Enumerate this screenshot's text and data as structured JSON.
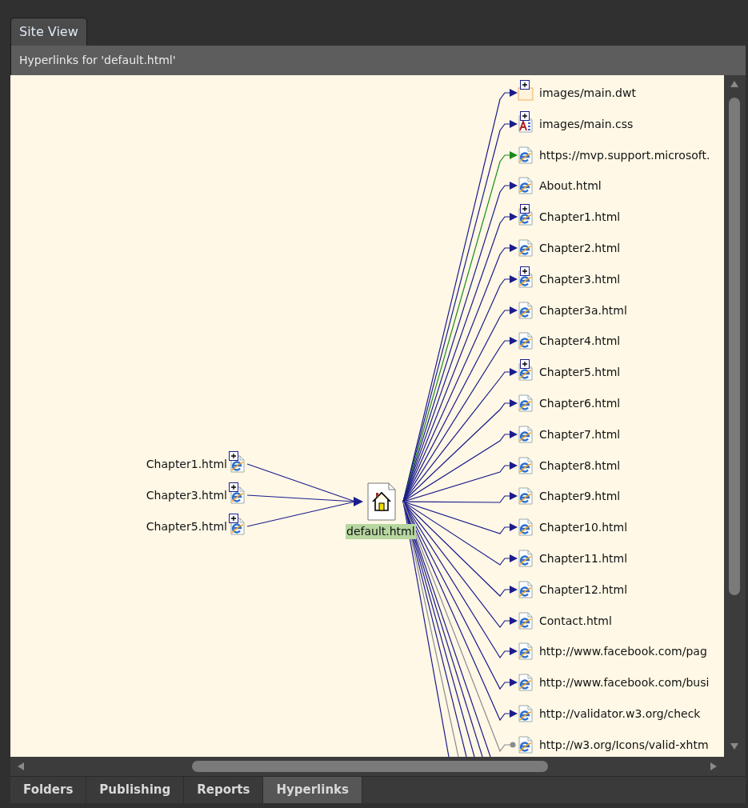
{
  "tabs": [
    {
      "label": "Site View",
      "selected": true
    }
  ],
  "header": "Hyperlinks for 'default.html'",
  "center": {
    "label": "default.html",
    "selected": true
  },
  "sources": [
    {
      "label": "Chapter1.html",
      "expandable": true
    },
    {
      "label": "Chapter3.html",
      "expandable": true
    },
    {
      "label": "Chapter5.html",
      "expandable": true
    }
  ],
  "targets": [
    {
      "label": "images/main.dwt",
      "kind": "template",
      "expandable": true,
      "color": "#1c1c8c"
    },
    {
      "label": "images/main.css",
      "kind": "stylesheet",
      "expandable": true,
      "color": "#1c1c8c"
    },
    {
      "label": "https://mvp.support.microsoft.",
      "kind": "page",
      "expandable": false,
      "color": "#1a8a1a"
    },
    {
      "label": "About.html",
      "kind": "page",
      "expandable": false,
      "color": "#1c1c8c"
    },
    {
      "label": "Chapter1.html",
      "kind": "page",
      "expandable": true,
      "color": "#1c1c8c"
    },
    {
      "label": "Chapter2.html",
      "kind": "page",
      "expandable": false,
      "color": "#1c1c8c"
    },
    {
      "label": "Chapter3.html",
      "kind": "page",
      "expandable": true,
      "color": "#1c1c8c"
    },
    {
      "label": "Chapter3a.html",
      "kind": "page",
      "expandable": false,
      "color": "#1c1c8c"
    },
    {
      "label": "Chapter4.html",
      "kind": "page",
      "expandable": false,
      "color": "#1c1c8c"
    },
    {
      "label": "Chapter5.html",
      "kind": "page",
      "expandable": true,
      "color": "#1c1c8c"
    },
    {
      "label": "Chapter6.html",
      "kind": "page",
      "expandable": false,
      "color": "#1c1c8c"
    },
    {
      "label": "Chapter7.html",
      "kind": "page",
      "expandable": false,
      "color": "#1c1c8c"
    },
    {
      "label": "Chapter8.html",
      "kind": "page",
      "expandable": false,
      "color": "#1c1c8c"
    },
    {
      "label": "Chapter9.html",
      "kind": "page",
      "expandable": false,
      "color": "#1c1c8c"
    },
    {
      "label": "Chapter10.html",
      "kind": "page",
      "expandable": false,
      "color": "#1c1c8c"
    },
    {
      "label": "Chapter11.html",
      "kind": "page",
      "expandable": false,
      "color": "#1c1c8c"
    },
    {
      "label": "Chapter12.html",
      "kind": "page",
      "expandable": false,
      "color": "#1c1c8c"
    },
    {
      "label": "Contact.html",
      "kind": "page",
      "expandable": false,
      "color": "#1c1c8c"
    },
    {
      "label": "http://www.facebook.com/pag",
      "kind": "page",
      "expandable": false,
      "color": "#1c1c8c"
    },
    {
      "label": "http://www.facebook.com/busi",
      "kind": "page",
      "expandable": false,
      "color": "#1c1c8c"
    },
    {
      "label": "http://validator.w3.org/check",
      "kind": "page",
      "expandable": false,
      "color": "#1c1c8c"
    },
    {
      "label": "http://w3.org/Icons/valid-xhtm",
      "kind": "page",
      "expandable": false,
      "color": "#8c8c8c",
      "unchecked": true
    }
  ],
  "bottom_tabs": [
    {
      "label": "Folders",
      "selected": false
    },
    {
      "label": "Publishing",
      "selected": false
    },
    {
      "label": "Reports",
      "selected": false
    },
    {
      "label": "Hyperlinks",
      "selected": true
    }
  ]
}
